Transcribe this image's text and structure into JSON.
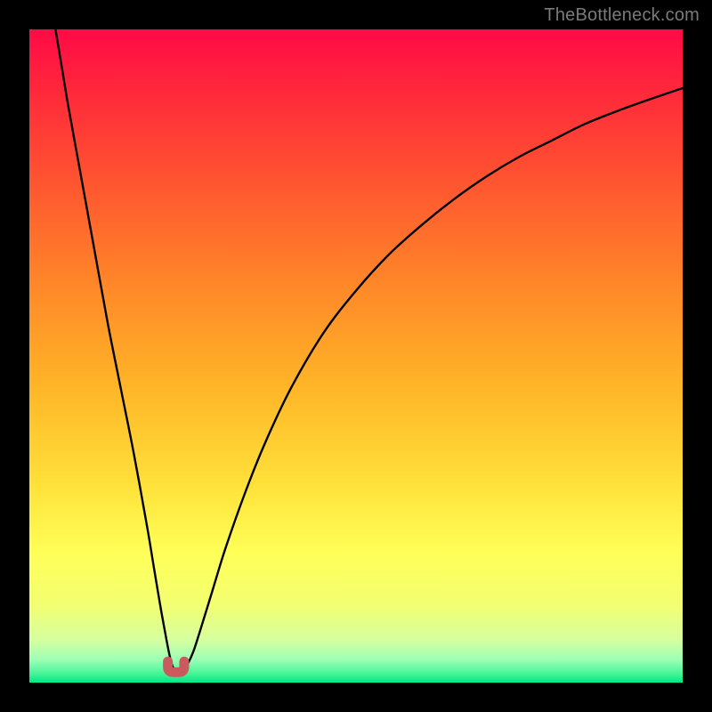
{
  "watermark": "TheBottleneck.com",
  "colors": {
    "frame": "#000000",
    "curve": "#000000",
    "marker": "#ca5a5d",
    "gradient_stops": [
      {
        "offset": 0.0,
        "color": "#ff0a46"
      },
      {
        "offset": 0.1,
        "color": "#ff2a3a"
      },
      {
        "offset": 0.25,
        "color": "#ff5a2f"
      },
      {
        "offset": 0.4,
        "color": "#ff8a28"
      },
      {
        "offset": 0.55,
        "color": "#ffb628"
      },
      {
        "offset": 0.7,
        "color": "#ffe23a"
      },
      {
        "offset": 0.8,
        "color": "#ffff58"
      },
      {
        "offset": 0.88,
        "color": "#f3ff70"
      },
      {
        "offset": 0.935,
        "color": "#d6ffa0"
      },
      {
        "offset": 0.965,
        "color": "#9cffb6"
      },
      {
        "offset": 0.985,
        "color": "#4cf59a"
      },
      {
        "offset": 1.0,
        "color": "#00e884"
      }
    ]
  },
  "chart_data": {
    "type": "line",
    "title": "",
    "xlabel": "",
    "ylabel": "",
    "xlim": [
      0,
      100
    ],
    "ylim": [
      0,
      100
    ],
    "series": [
      {
        "name": "bottleneck-curve",
        "x": [
          4,
          5,
          6,
          8,
          10,
          12,
          14,
          16,
          18,
          19,
          20,
          21,
          21.5,
          22,
          22.5,
          23,
          23.9,
          25,
          26,
          28,
          30,
          33,
          36,
          40,
          45,
          50,
          55,
          60,
          65,
          70,
          75,
          80,
          85,
          90,
          95,
          100
        ],
        "y": [
          100,
          94,
          88,
          77,
          66,
          55,
          45,
          35,
          24,
          18,
          12,
          6.5,
          4,
          2.3,
          1.6,
          1.6,
          2.3,
          4.5,
          7.5,
          14,
          20.5,
          29,
          36.5,
          45,
          53.5,
          60,
          65.5,
          70,
          74,
          77.5,
          80.5,
          83,
          85.5,
          87.5,
          89.3,
          91
        ]
      }
    ],
    "marker": {
      "name": "optimum-marker",
      "shape": "u",
      "x_range": [
        21.2,
        23.7
      ],
      "y": 1.6
    }
  }
}
